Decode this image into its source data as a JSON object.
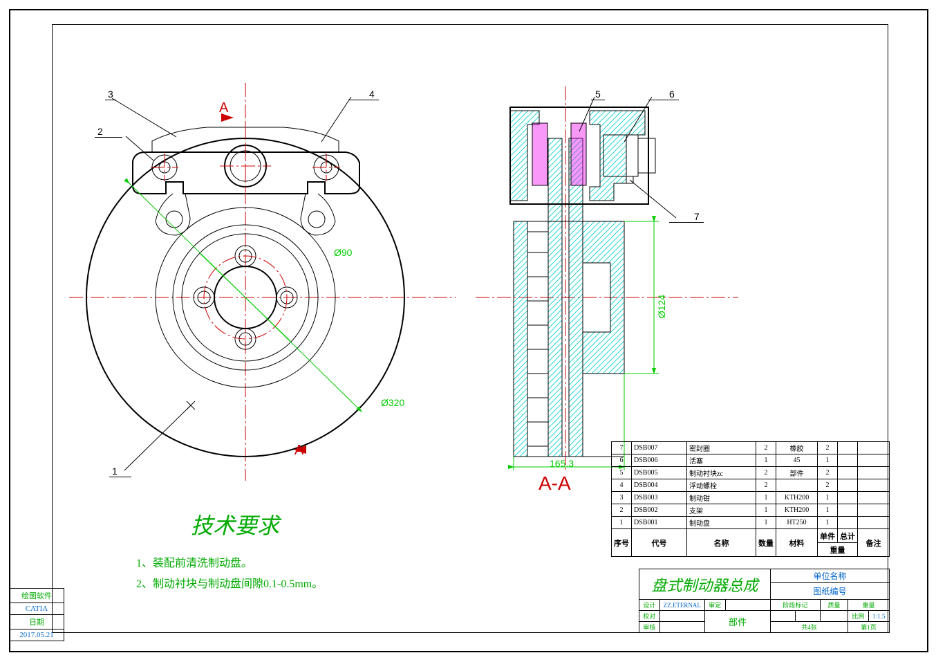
{
  "sidebar": {
    "row1": "绘图软件",
    "row2": "CATIA",
    "row3": "日期",
    "row4": "2017.05.21"
  },
  "balloons": {
    "b1": "1",
    "b2": "2",
    "b3": "3",
    "b4": "4",
    "b5": "5",
    "b6": "6",
    "b7": "7"
  },
  "section": {
    "markA1": "A",
    "markA2": "A",
    "title": "A-A"
  },
  "dims": {
    "d90": "Ø90",
    "d320": "Ø320",
    "d124": "Ø124",
    "w165": "165.3"
  },
  "requirements": {
    "title": "技术要求",
    "line1": "1、装配前清洗制动盘。",
    "line2": "2、制动衬块与制动盘间隙0.1-0.5mm。"
  },
  "bom": {
    "headers": {
      "seq": "序号",
      "code": "代号",
      "name": "名称",
      "qty": "数量",
      "mat": "材料",
      "w1": "单件",
      "w2": "总计",
      "wg": "重量",
      "note": "备注"
    },
    "rows": [
      {
        "seq": "7",
        "code": "DSB007",
        "name": "密封圈",
        "qty": "2",
        "mat": "橡胶",
        "w1": "2",
        "w2": "",
        "note": ""
      },
      {
        "seq": "6",
        "code": "DSB006",
        "name": "活塞",
        "qty": "1",
        "mat": "45",
        "w1": "1",
        "w2": "",
        "note": ""
      },
      {
        "seq": "5",
        "code": "DSB005",
        "name": "制动衬块zc",
        "qty": "2",
        "mat": "部件",
        "w1": "2",
        "w2": "",
        "note": ""
      },
      {
        "seq": "4",
        "code": "DSB004",
        "name": "浮动螺栓",
        "qty": "2",
        "mat": "",
        "w1": "2",
        "w2": "",
        "note": ""
      },
      {
        "seq": "3",
        "code": "DSB003",
        "name": "制动钳",
        "qty": "1",
        "mat": "KTH200",
        "w1": "1",
        "w2": "",
        "note": ""
      },
      {
        "seq": "2",
        "code": "DSB002",
        "name": "支架",
        "qty": "1",
        "mat": "KTH200",
        "w1": "1",
        "w2": "",
        "note": ""
      },
      {
        "seq": "1",
        "code": "DSB001",
        "name": "制动盘",
        "qty": "1",
        "mat": "HT250",
        "w1": "1",
        "w2": "",
        "note": ""
      }
    ]
  },
  "title_block": {
    "main_title": "盘式制动器总成",
    "unit": "单位名称",
    "drawing_no": "图纸编号",
    "design": "设计",
    "designer": "ZZ.ETERNAL",
    "review": "审定",
    "check": "校对",
    "part": "部件",
    "approve": "审核",
    "stage": "阶段标记",
    "mass": "质量",
    "weight": "重量",
    "scale": "比例",
    "scale_val": "1:1.5",
    "sheets": "共4张",
    "page": "第1页"
  }
}
